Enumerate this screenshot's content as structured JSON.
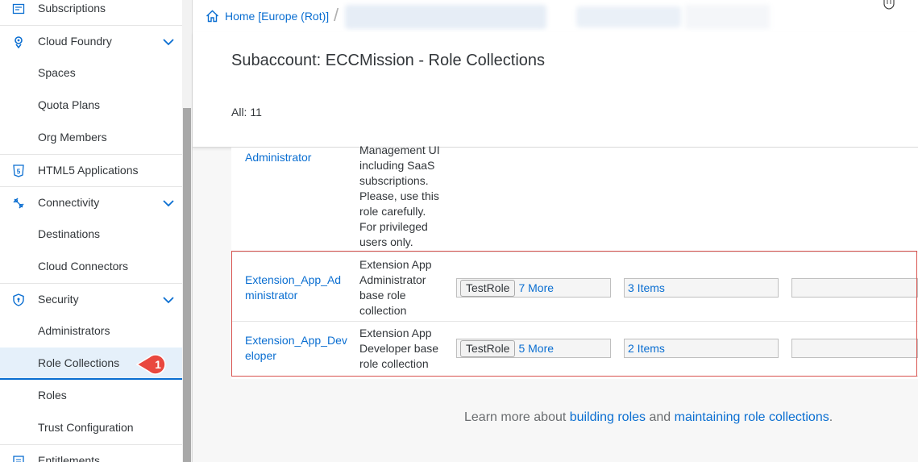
{
  "sidebar": {
    "items": [
      {
        "label": "Subscriptions",
        "icon": "subscriptions-icon"
      },
      {
        "label": "Cloud Foundry",
        "icon": "cloud-foundry-icon",
        "expandable": true
      },
      {
        "label": "Spaces"
      },
      {
        "label": "Quota Plans"
      },
      {
        "label": "Org Members"
      },
      {
        "label": "HTML5 Applications",
        "icon": "html5-icon"
      },
      {
        "label": "Connectivity",
        "icon": "connectivity-icon",
        "expandable": true
      },
      {
        "label": "Destinations"
      },
      {
        "label": "Cloud Connectors"
      },
      {
        "label": "Security",
        "icon": "security-shield-icon",
        "expandable": true
      },
      {
        "label": "Administrators"
      },
      {
        "label": "Role Collections",
        "selected": true
      },
      {
        "label": "Roles"
      },
      {
        "label": "Trust Configuration"
      },
      {
        "label": "Entitlements",
        "icon": "entitlements-icon"
      }
    ],
    "callout_number": "1"
  },
  "breadcrumb": {
    "home_label": "Home [Europe (Rot)]",
    "separator": "/"
  },
  "page": {
    "title": "Subaccount: ECCMission - Role Collections",
    "count_label": "All: 11"
  },
  "table": {
    "partial_row": {
      "name": "Administrator",
      "description_lines": [
        "Management UI",
        "including SaaS",
        "subscriptions.",
        "Please, use this",
        "role carefully.",
        "For privileged",
        "users only."
      ]
    },
    "rows": [
      {
        "name_lines": [
          "Extension_App_Ad",
          "ministrator"
        ],
        "description_lines": [
          "Extension App",
          "Administrator",
          "base role",
          "collection"
        ],
        "role_token": "TestRole",
        "roles_more": "7 More",
        "users": "3 Items"
      },
      {
        "name_lines": [
          "Extension_App_Dev",
          "eloper"
        ],
        "description_lines": [
          "Extension App",
          "Developer base",
          "role collection"
        ],
        "role_token": "TestRole",
        "roles_more": "5 More",
        "users": "2 Items"
      }
    ]
  },
  "footer": {
    "prefix": "Learn more about ",
    "link1": "building roles",
    "middle": " and ",
    "link2": "maintaining role collections",
    "suffix": "."
  },
  "colors": {
    "accent": "#0a6ed1",
    "highlight_border": "#d9534f",
    "callout": "#e9483f",
    "selected_bg": "#e5f0fa"
  }
}
